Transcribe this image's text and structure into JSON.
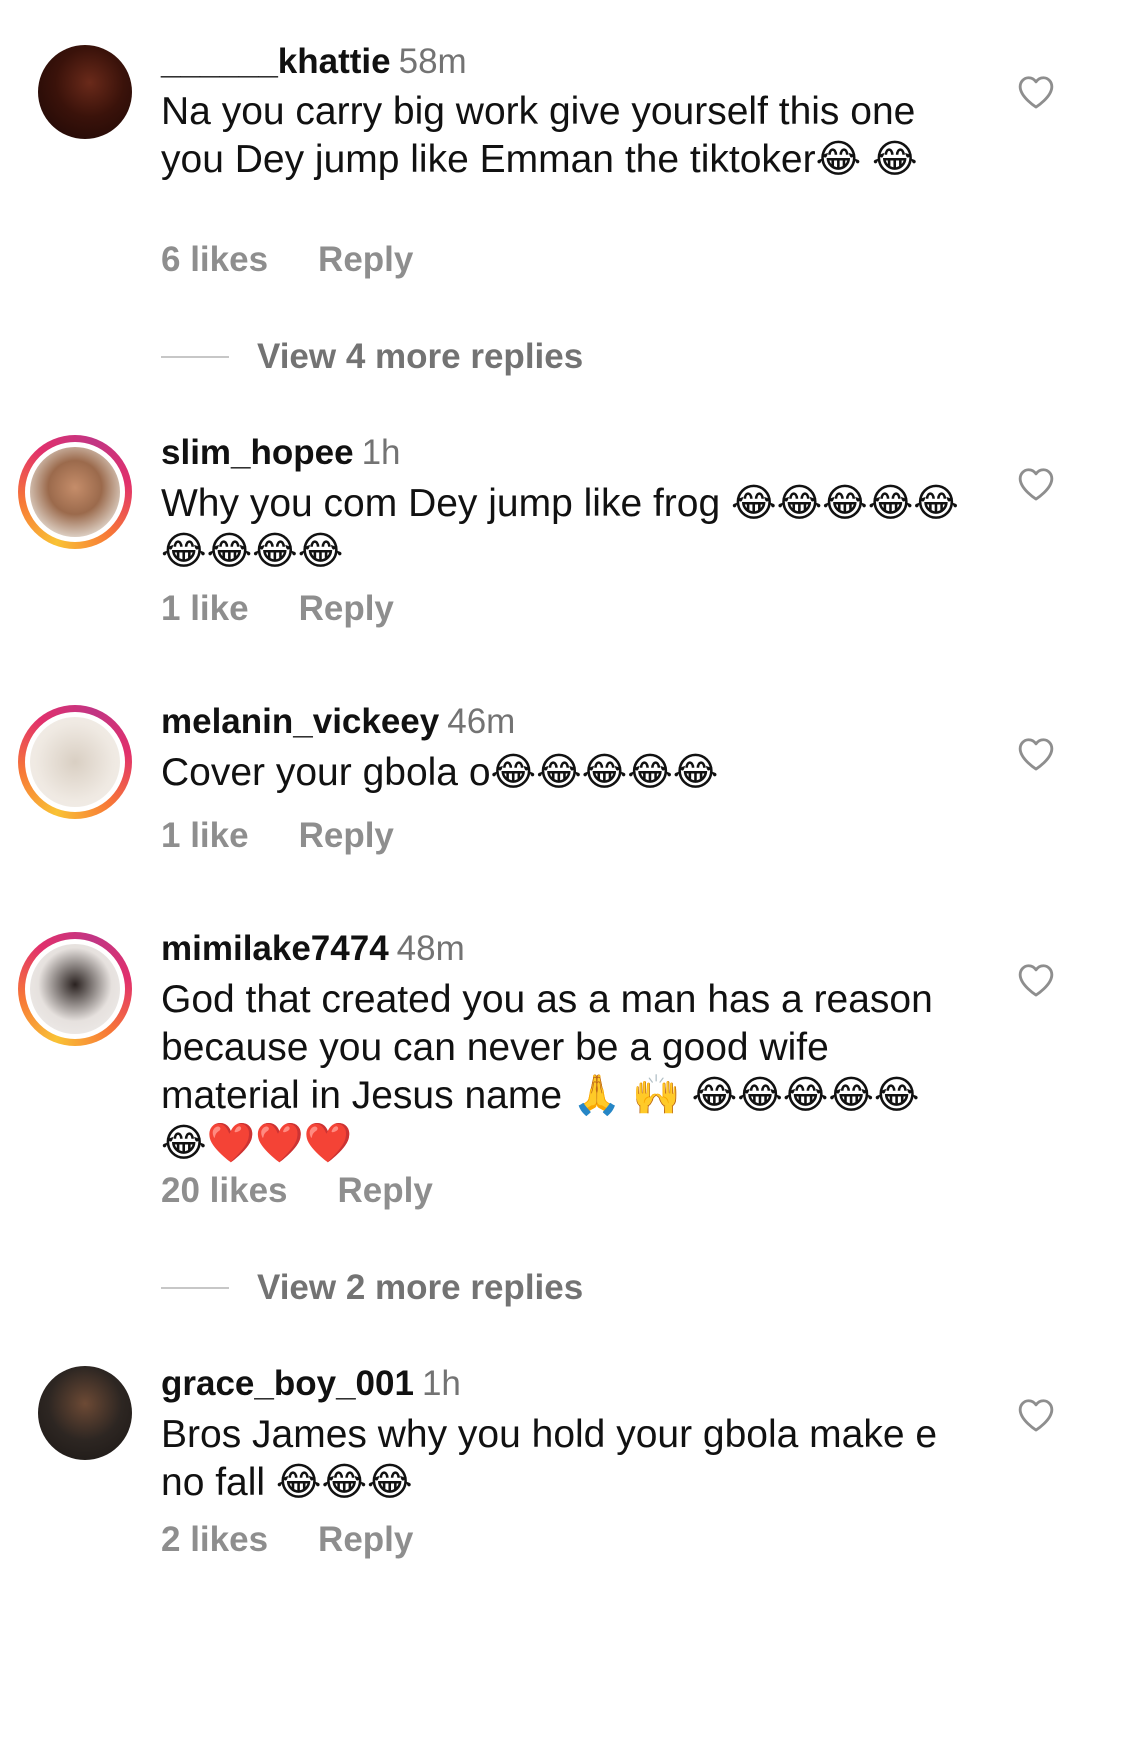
{
  "comments": [
    {
      "username": "______khattie",
      "time": "58m",
      "text": "Na you carry big work give yourself this one you Dey jump like Emman the tiktoker😂 😂",
      "likes": "6 likes",
      "reply": "Reply",
      "view_more": "View 4 more replies",
      "has_story_ring": false
    },
    {
      "username": "slim_hopee",
      "time": "1h",
      "text": "Why you com Dey jump like frog 😂😂😂😂😂😂😂😂😂",
      "likes": "1 like",
      "reply": "Reply",
      "has_story_ring": true
    },
    {
      "username": "melanin_vickeey",
      "time": "46m",
      "text": "Cover your gbola o😂😂😂😂😂",
      "likes": "1 like",
      "reply": "Reply",
      "has_story_ring": true
    },
    {
      "username": "mimilake7474",
      "time": "48m",
      "text": "God that created you as a man has a reason because you can never be a good wife material in Jesus name 🙏 🙌 😂😂😂😂😂😂❤️❤️❤️",
      "likes": "20 likes",
      "reply": "Reply",
      "view_more": "View 2 more replies",
      "has_story_ring": true
    },
    {
      "username": "grace_boy_001",
      "time": "1h",
      "text": "Bros James why you hold your gbola make e no fall 😂😂😂",
      "likes": "2 likes",
      "reply": "Reply",
      "has_story_ring": false
    }
  ],
  "icons": {
    "like": "heart-outline-icon"
  },
  "colors": {
    "text": "#111111",
    "secondary": "#737373",
    "action": "#8e8e8e",
    "divider": "#c7c7c7"
  }
}
